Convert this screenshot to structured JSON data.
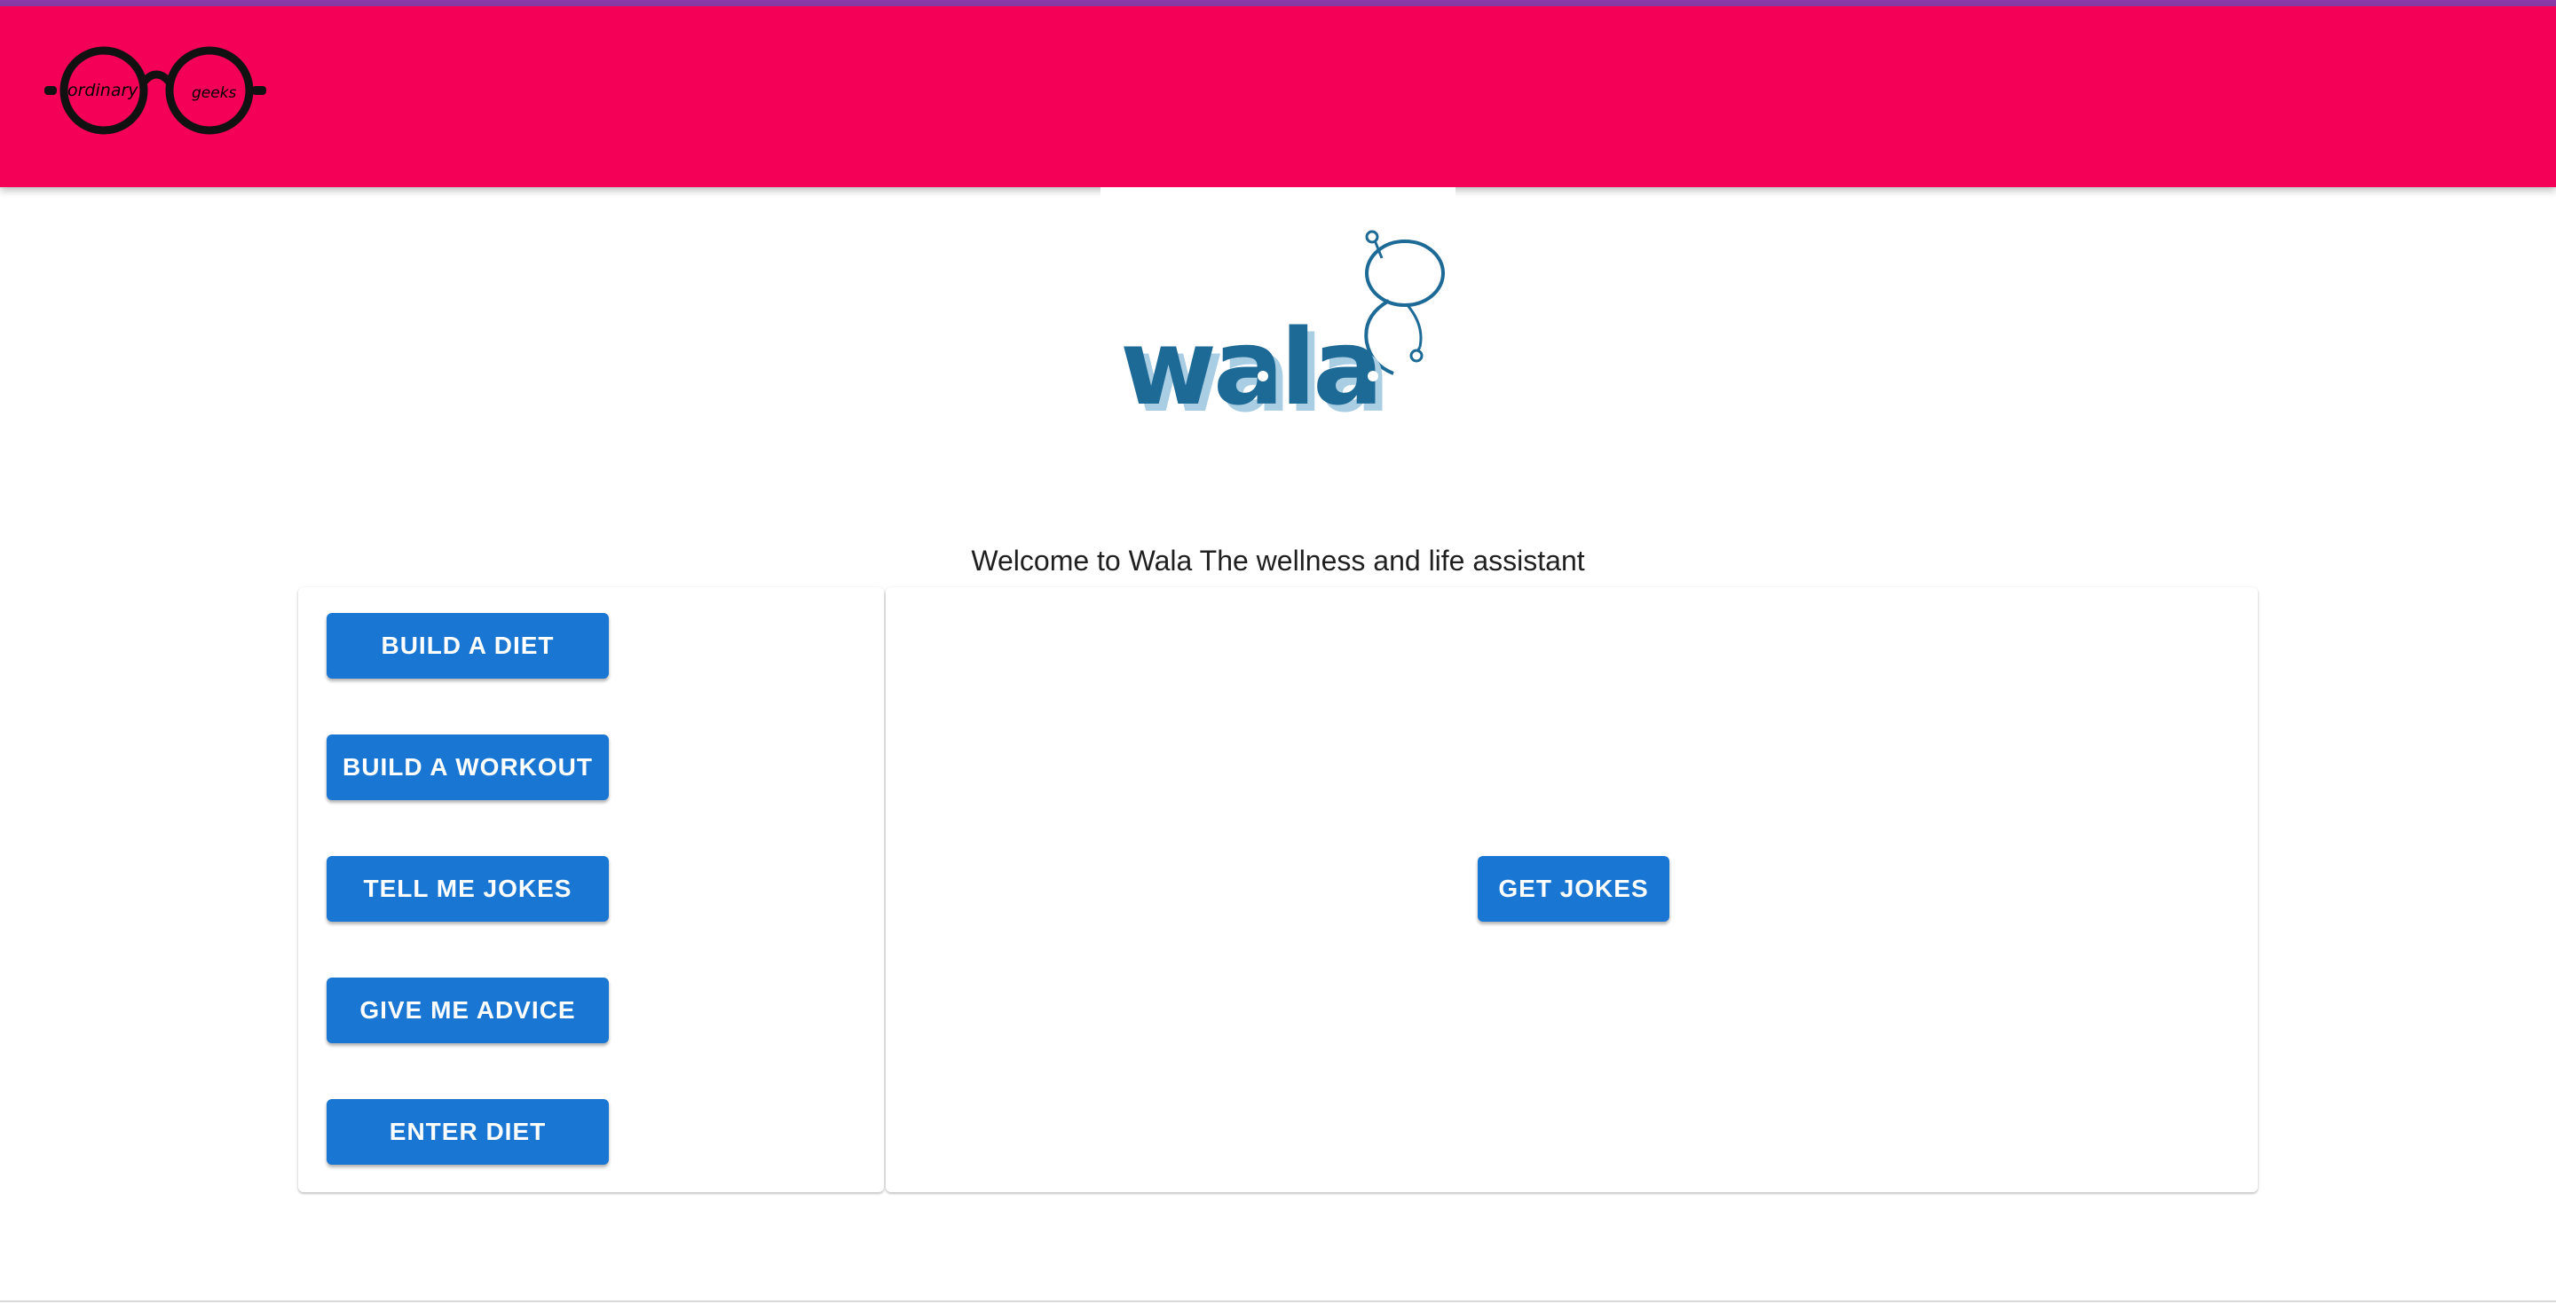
{
  "header": {
    "brand_words": [
      "ordinary",
      "geeks"
    ],
    "color": "#f50057"
  },
  "hero": {
    "logo_text": "wala"
  },
  "welcome_text": "Welcome to Wala The wellness and life assistant",
  "menu": {
    "buttons": [
      "BUILD A DIET",
      "BUILD A WORKOUT",
      "TELL ME JOKES",
      "GIVE ME ADVICE",
      "ENTER DIET"
    ]
  },
  "content": {
    "action_button": "GET JOKES"
  },
  "colors": {
    "primary": "#1976d2",
    "accent": "#f50057",
    "logo_blue": "#1d6a96"
  }
}
